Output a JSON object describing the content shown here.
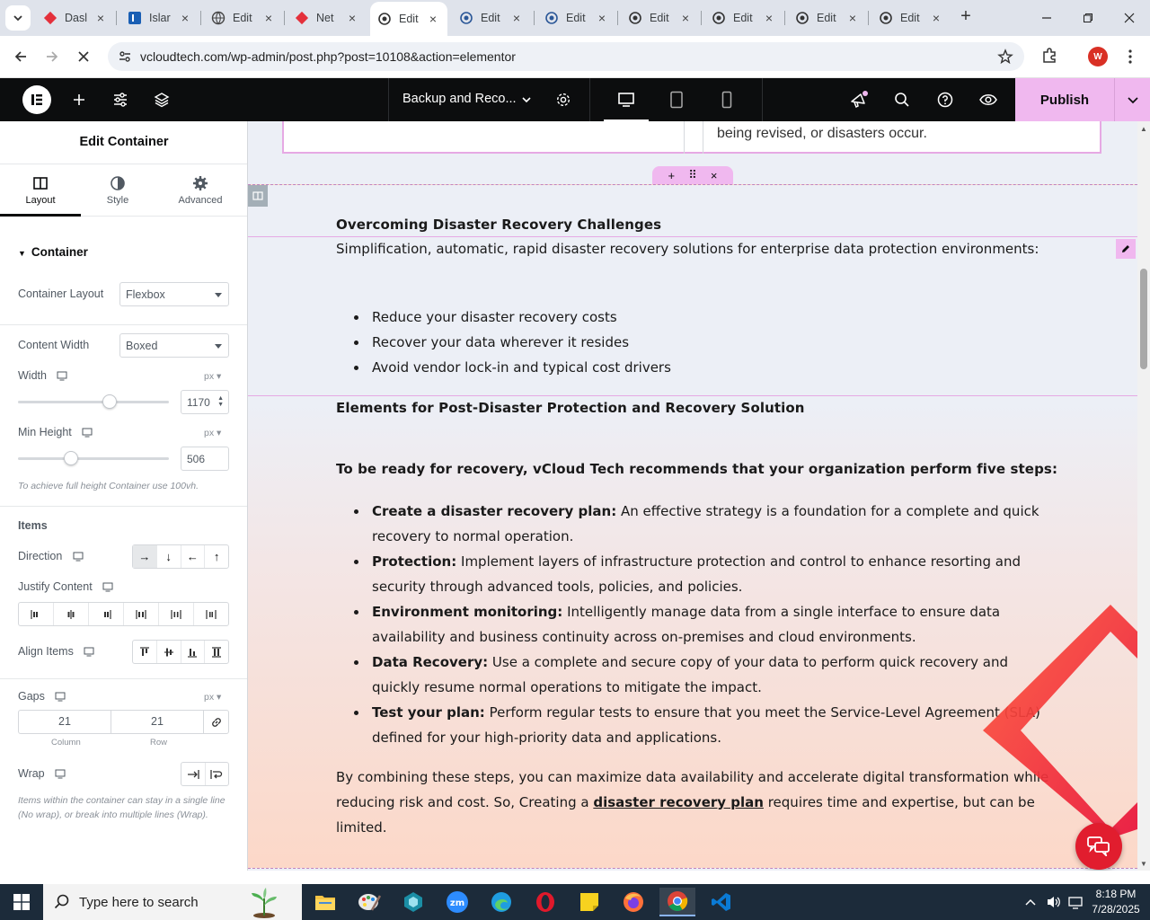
{
  "browser": {
    "tabs": [
      {
        "label": "Dasl",
        "icon": "red-diamond-icon"
      },
      {
        "label": "Islar",
        "icon": "blue-square-icon"
      },
      {
        "label": "Edit",
        "icon": "globe-icon"
      },
      {
        "label": "Net",
        "icon": "red-diamond-icon"
      },
      {
        "label": "Edit",
        "icon": "elementor-swirl-icon",
        "active": true
      },
      {
        "label": "Edit",
        "icon": "elementor-swirl-icon"
      },
      {
        "label": "Edit",
        "icon": "elementor-swirl-icon"
      },
      {
        "label": "Edit",
        "icon": "elementor-swirl-icon"
      },
      {
        "label": "Edit",
        "icon": "elementor-swirl-icon"
      },
      {
        "label": "Edit",
        "icon": "elementor-swirl-icon"
      },
      {
        "label": "Edit",
        "icon": "elementor-swirl-icon"
      }
    ],
    "url": "vcloudtech.com/wp-admin/post.php?post=10108&action=elementor",
    "profile_initial": "W"
  },
  "elementor": {
    "page_title": "Backup and Reco...",
    "publish_label": "Publish"
  },
  "panel": {
    "title": "Edit Container",
    "tabs": [
      {
        "label": "Layout"
      },
      {
        "label": "Style"
      },
      {
        "label": "Advanced"
      }
    ],
    "section": "Container",
    "container_layout": {
      "label": "Container Layout",
      "value": "Flexbox"
    },
    "content_width": {
      "label": "Content Width",
      "value": "Boxed"
    },
    "width": {
      "label": "Width",
      "unit": "px",
      "value": "1170",
      "slider_fraction": 0.61
    },
    "min_height": {
      "label": "Min Height",
      "unit": "px",
      "value": "506",
      "slider_fraction": 0.35
    },
    "min_height_hint": "To achieve full height Container use 100vh.",
    "items_heading": "Items",
    "direction": {
      "label": "Direction"
    },
    "justify_content": {
      "label": "Justify Content"
    },
    "align_items": {
      "label": "Align Items"
    },
    "gaps": {
      "label": "Gaps",
      "unit": "px",
      "column": "21",
      "row": "21",
      "column_caption": "Column",
      "row_caption": "Row"
    },
    "wrap": {
      "label": "Wrap"
    },
    "wrap_hint": "Items within the container can stay in a single line (No wrap), or break into multiple lines (Wrap)."
  },
  "canvas": {
    "previous_text": "being revised, or disasters occur.",
    "heading1": "Overcoming Disaster Recovery Challenges",
    "intro": "Simplification, automatic, rapid disaster recovery solutions for enterprise data protection environments:",
    "bullets1": [
      "Reduce your disaster recovery costs",
      "Recover your data wherever it resides",
      "Avoid vendor lock-in and typical cost drivers"
    ],
    "heading2": "Elements for Post-Disaster Protection and Recovery Solution",
    "heading3": "To be ready for recovery, vCloud Tech recommends that your organization perform five steps:",
    "steps": [
      {
        "title": "Create a disaster recovery plan:",
        "text": "An effective strategy is a foundation for a complete and quick recovery to normal operation."
      },
      {
        "title": "Protection:",
        "text": "Implement layers of infrastructure protection and control to enhance resorting and security through advanced tools, policies, and policies."
      },
      {
        "title": "Environment monitoring:",
        "text": "Intelligently manage data from a single interface to ensure data availability and business continuity across on-premises and cloud environments."
      },
      {
        "title": "Data Recovery:",
        "text": "Use a complete and secure copy of your data to perform quick recovery and quickly resume normal operations to mitigate the impact."
      },
      {
        "title": "Test your plan:",
        "text": "Perform regular tests to ensure that you meet the Service-Level Agreement (SLA) defined for your high-priority data and applications."
      }
    ],
    "closing_before": "By combining these steps, you can maximize data availability and accelerate digital transformation while reducing risk and cost. So, Creating a ",
    "closing_link": "disaster recovery plan",
    "closing_after": " requires time and expertise, but can be limited."
  },
  "taskbar": {
    "search_placeholder": "Type here to search",
    "time": "8:18 PM",
    "date": "7/28/2025"
  }
}
